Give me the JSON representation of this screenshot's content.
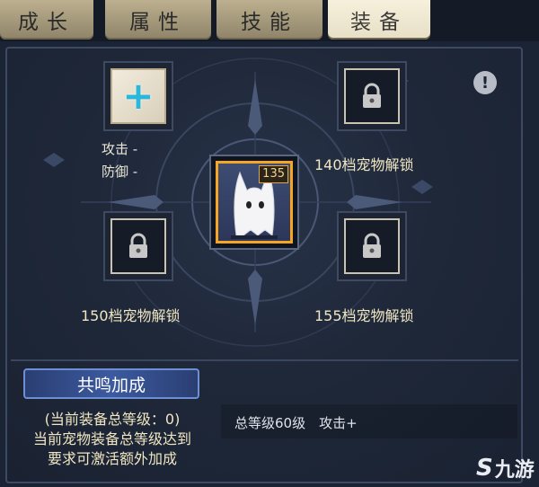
{
  "tabs": [
    {
      "label": "成长",
      "active": false
    },
    {
      "label": "属性",
      "active": false
    },
    {
      "label": "技能",
      "active": false
    },
    {
      "label": "装备",
      "active": true
    }
  ],
  "slots": {
    "top_left": {
      "state": "add",
      "icon": "plus-icon"
    },
    "top_right": {
      "state": "locked",
      "icon": "lock-icon",
      "label": "140档宠物解锁"
    },
    "bottom_left": {
      "state": "locked",
      "icon": "lock-icon",
      "label": "150档宠物解锁"
    },
    "bottom_right": {
      "state": "locked",
      "icon": "lock-icon",
      "label": "155档宠物解锁"
    }
  },
  "stats": {
    "attack": "攻击 -",
    "defense": "防御 -"
  },
  "pet": {
    "level": "135",
    "icon": "pet-ghost-icon"
  },
  "info_icon": "exclamation-icon",
  "resonance": {
    "title": "共鸣加成",
    "current_level": "(当前装备总等级：0)",
    "description_line1": "当前宠物装备总等级达到",
    "description_line2": "要求可激活额外加成",
    "bonus": "总等级60级　攻击+"
  },
  "watermark": {
    "logo": "S",
    "text": "九游"
  },
  "colors": {
    "accent_gold": "#f3a523",
    "label_text": "#f0e6c2",
    "tab_active": "#f6f0dc",
    "tab_inactive": "#bdb08f",
    "panel_bg": "#1b2434",
    "resonance_blue": "#3c5aa0"
  }
}
